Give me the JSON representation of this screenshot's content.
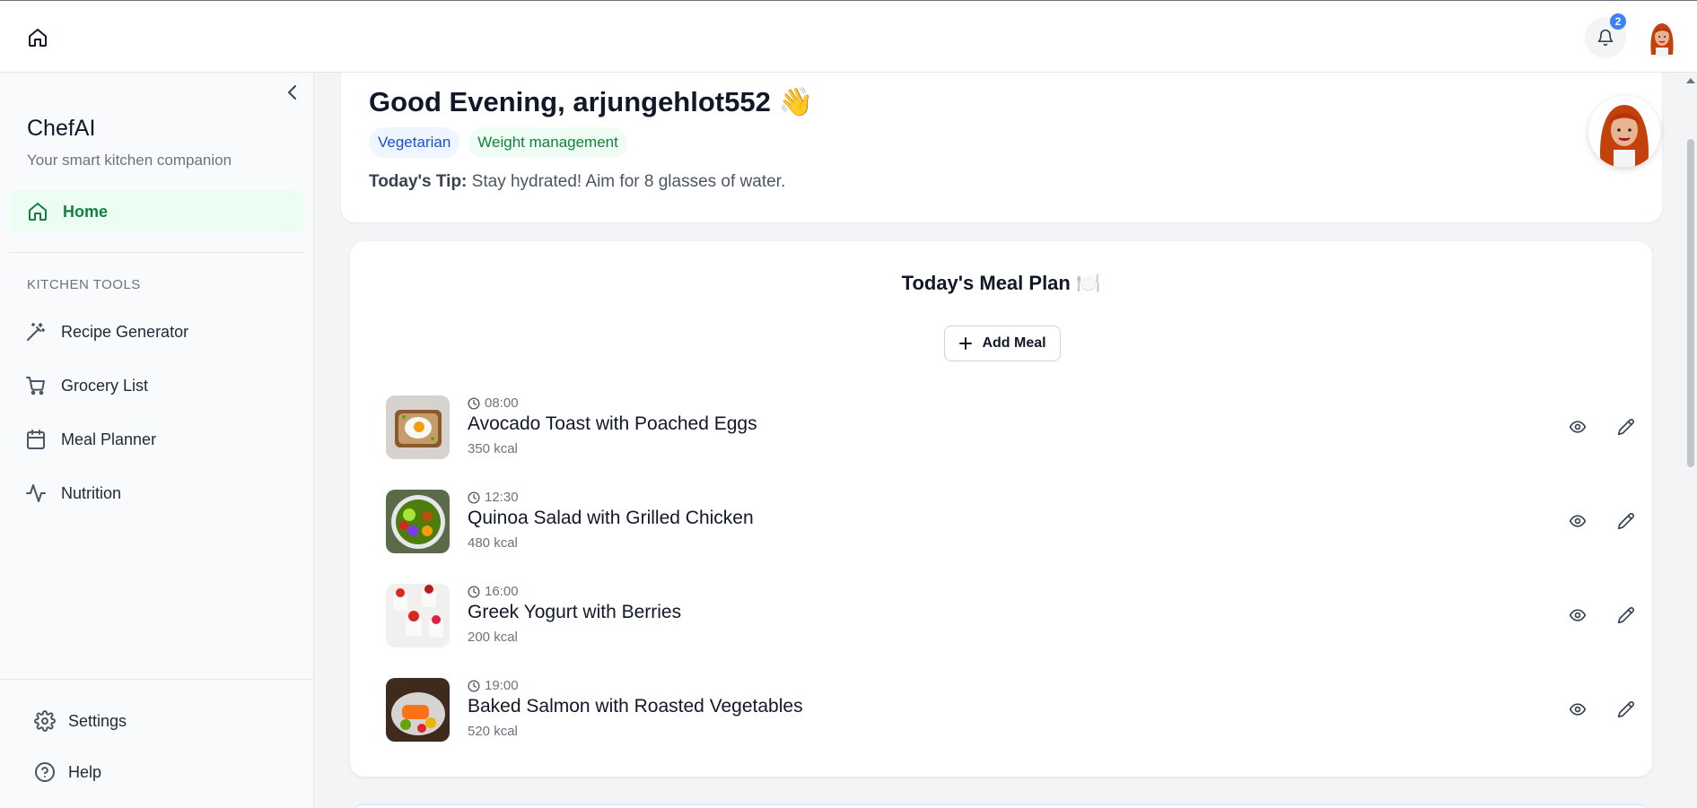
{
  "topbar": {
    "home_icon": "home-icon",
    "bell_icon": "bell-icon",
    "notification_count": "2"
  },
  "sidebar": {
    "brand": "ChefAI",
    "tagline": "Your smart kitchen companion",
    "home_label": "Home",
    "section_label": "KITCHEN TOOLS",
    "tools": [
      {
        "label": "Recipe Generator",
        "icon": "magic-wand-icon"
      },
      {
        "label": "Grocery List",
        "icon": "cart-icon"
      },
      {
        "label": "Meal Planner",
        "icon": "calendar-icon"
      },
      {
        "label": "Nutrition",
        "icon": "activity-icon"
      }
    ],
    "settings_label": "Settings",
    "help_label": "Help"
  },
  "greeting": {
    "text": "Good Evening, arjungehlot552 👋",
    "tags": [
      "Vegetarian",
      "Weight management"
    ],
    "tip_label": "Today's Tip:",
    "tip_text": " Stay hydrated! Aim for 8 glasses of water."
  },
  "meal_plan": {
    "title": "Today's Meal Plan 🍽️",
    "add_label": "Add Meal",
    "meals": [
      {
        "time": "08:00",
        "name": "Avocado Toast with Poached Eggs",
        "kcal": "350 kcal"
      },
      {
        "time": "12:30",
        "name": "Quinoa Salad with Grilled Chicken",
        "kcal": "480 kcal"
      },
      {
        "time": "16:00",
        "name": "Greek Yogurt with Berries",
        "kcal": "200 kcal"
      },
      {
        "time": "19:00",
        "name": "Baked Salmon with Roasted Vegetables",
        "kcal": "520 kcal"
      }
    ]
  },
  "colors": {
    "accent_green": "#15803d",
    "active_bg": "#ecfdf3",
    "tag_blue": "#1d4ed8",
    "badge_blue": "#3b82f6"
  }
}
